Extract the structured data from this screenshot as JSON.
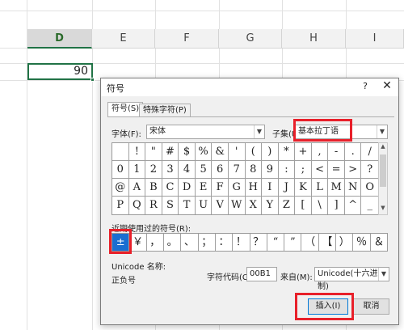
{
  "sheet": {
    "columns": [
      {
        "name": "D",
        "selected": true
      },
      {
        "name": "E",
        "selected": false
      },
      {
        "name": "F",
        "selected": false
      },
      {
        "name": "G",
        "selected": false
      },
      {
        "name": "H",
        "selected": false
      },
      {
        "name": "I",
        "selected": false
      }
    ],
    "active_cell_value": "90",
    "accent_color": "#217346"
  },
  "dialog": {
    "title": "符号",
    "help": "?",
    "close": "✕",
    "tabs": [
      {
        "label": "符号(S)",
        "active": true
      },
      {
        "label": "特殊字符(P)",
        "active": false
      }
    ],
    "font_label": "字体(F):",
    "font_value": "宋体",
    "subset_label": "子集(U):",
    "subset_value": "基本拉丁语",
    "symbol_grid": [
      [
        " ",
        "!",
        "\"",
        "#",
        "$",
        "%",
        "&",
        "'",
        "(",
        ")",
        "*",
        "+",
        ",",
        "-",
        ".",
        "/"
      ],
      [
        "0",
        "1",
        "2",
        "3",
        "4",
        "5",
        "6",
        "7",
        "8",
        "9",
        ":",
        ";",
        "<",
        "=",
        ">",
        "?"
      ],
      [
        "@",
        "A",
        "B",
        "C",
        "D",
        "E",
        "F",
        "G",
        "H",
        "I",
        "J",
        "K",
        "L",
        "M",
        "N",
        "O"
      ],
      [
        "P",
        "Q",
        "R",
        "S",
        "T",
        "U",
        "V",
        "W",
        "X",
        "Y",
        "Z",
        "[",
        "\\",
        "]",
        "^",
        "_"
      ]
    ],
    "recent_label": "近期使用过的符号(R):",
    "recent_symbols": [
      "±",
      "￥",
      "，",
      "。",
      "、",
      "；",
      "：",
      "！",
      "？",
      "“",
      "”",
      "（",
      "【",
      "）",
      "％",
      "＆"
    ],
    "unicode_name_label": "Unicode 名称:",
    "unicode_name_value": "正负号",
    "char_code_label": "字符代码(C):",
    "char_code_value": "00B1",
    "from_label": "来自(M):",
    "from_value": "Unicode(十六进制)",
    "insert_button": "插入(I)",
    "cancel_button": "取消",
    "highlight_color": "#e8202a",
    "selection_color": "#1a6ed1"
  }
}
